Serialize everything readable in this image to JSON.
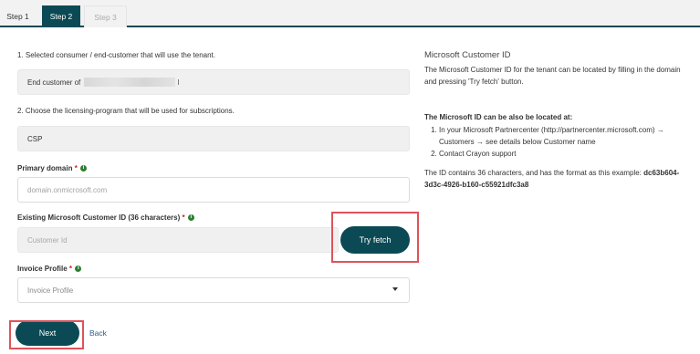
{
  "tabs": [
    {
      "label": "Step 1"
    },
    {
      "label": "Step 2"
    },
    {
      "label": "Step 3"
    }
  ],
  "form": {
    "section1_label": "1. Selected consumer / end-customer that will use the tenant.",
    "consumer_value": "End customer of",
    "consumer_value_end": "I",
    "section2_label": "2. Choose the licensing-program that will be used for subscriptions.",
    "program_value": "CSP",
    "primary_domain_label": "Primary domain",
    "primary_domain_placeholder": "domain.onmicrosoft.com",
    "customer_id_label": "Existing Microsoft Customer ID (36 characters)",
    "customer_id_placeholder": "Customer Id",
    "try_fetch_label": "Try fetch",
    "invoice_profile_label": "Invoice Profile",
    "invoice_profile_placeholder": "Invoice Profile",
    "required_mark": "*",
    "info_glyph": "i",
    "next_label": "Next",
    "back_label": "Back"
  },
  "sidebar": {
    "title": "Microsoft Customer ID",
    "intro": "The Microsoft Customer ID for the tenant can be located by filling in the domain and pressing 'Try fetch' button.",
    "located_heading": "The Microsoft ID can be also be located at:",
    "located_items": [
      "In your Microsoft Partnercenter (http://partnercenter.microsoft.com) → Customers → see details below Customer name",
      "Contact Crayon support"
    ],
    "format_text": "The ID contains 36 characters, and has the format as this example:",
    "format_example": "dc63b604-3d3c-4926-b160-c55921dfc3a8"
  },
  "colors": {
    "accent": "#0b4a55",
    "highlight": "#e0525a",
    "required": "#d02020",
    "info": "#2e7d32"
  }
}
